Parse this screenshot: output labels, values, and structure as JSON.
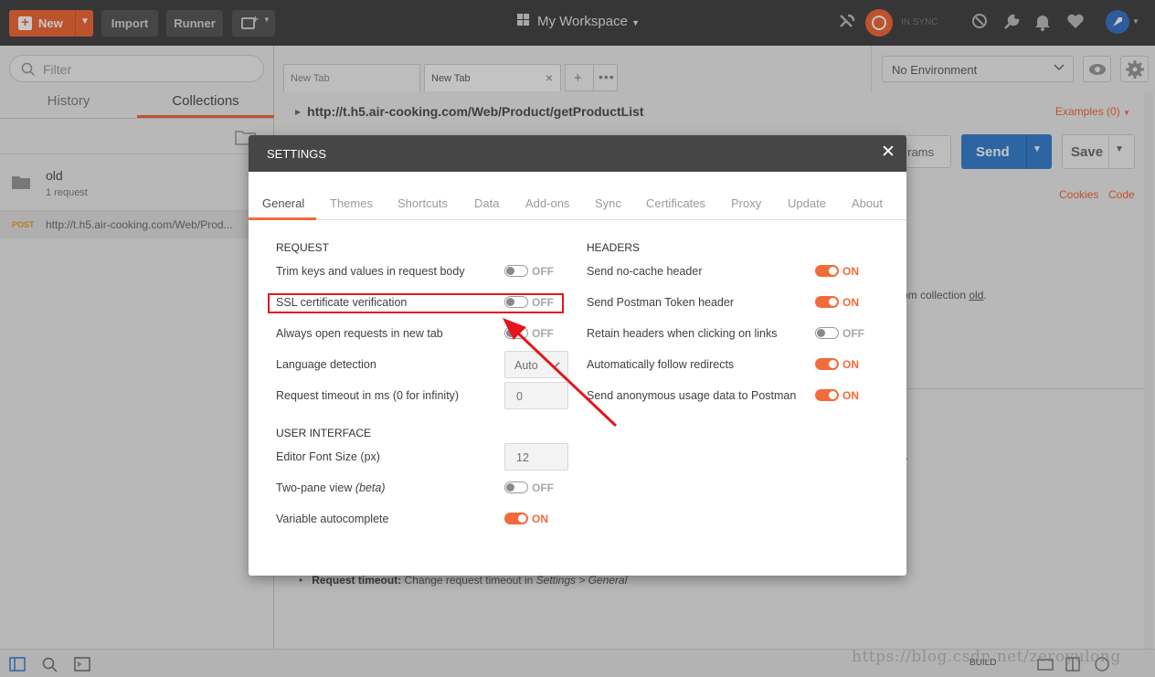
{
  "header": {
    "new_label": "New",
    "import_label": "Import",
    "runner_label": "Runner",
    "workspace_label": "My Workspace",
    "sync_status": "IN SYNC"
  },
  "sidebar": {
    "filter_placeholder": "Filter",
    "tabs": [
      {
        "label": "History",
        "active": false
      },
      {
        "label": "Collections",
        "active": true
      }
    ],
    "collection": {
      "name": "old",
      "count": "1 request"
    },
    "request": {
      "method": "POST",
      "url": "http://t.h5.air-cooking.com/Web/Prod..."
    }
  },
  "main": {
    "tabs": [
      {
        "label": "New Tab",
        "active": false
      },
      {
        "label": "New Tab",
        "active": true
      }
    ],
    "environment": "No Environment",
    "request_title": "http://t.h5.air-cooking.com/Web/Product/getProductList",
    "examples_label": "Examples (0)",
    "params_label": "rams",
    "send_label": "Send",
    "save_label": "Save",
    "cookies_label": "Cookies",
    "code_label": "Code",
    "hint_prefix": "om collection ",
    "hint_link": "old",
    "hint_suffix": ".",
    "bullet_bold": "Request timeout:",
    "bullet_text": " Change request timeout in ",
    "bullet_italic": "Settings > General"
  },
  "statusbar": {
    "build_label": "BUILD",
    "watermark": "https://blog.csdn.net/zeroyulong"
  },
  "settings": {
    "title": "SETTINGS",
    "tabs": [
      "General",
      "Themes",
      "Shortcuts",
      "Data",
      "Add-ons",
      "Sync",
      "Certificates",
      "Proxy",
      "Update",
      "About"
    ],
    "active_tab": "General",
    "request": {
      "section": "REQUEST",
      "trim_label": "Trim keys and values in request body",
      "trim_state": "OFF",
      "ssl_label": "SSL certificate verification",
      "ssl_state": "OFF",
      "newtab_label": "Always open requests in new tab",
      "newtab_state": "OFF",
      "lang_label": "Language detection",
      "lang_value": "Auto",
      "timeout_label": "Request timeout in ms (0 for infinity)",
      "timeout_value": "0"
    },
    "ui": {
      "section": "USER INTERFACE",
      "font_label": "Editor Font Size (px)",
      "font_value": "12",
      "twopane_label": "Two-pane view",
      "twopane_beta": "(beta)",
      "twopane_state": "OFF",
      "autocomplete_label": "Variable autocomplete",
      "autocomplete_state": "ON"
    },
    "headers": {
      "section": "HEADERS",
      "nocache_label": "Send no-cache header",
      "nocache_state": "ON",
      "token_label": "Send Postman Token header",
      "token_state": "ON",
      "retain_label": "Retain headers when clicking on links",
      "retain_state": "OFF",
      "redirect_label": "Automatically follow redirects",
      "redirect_state": "ON",
      "anon_label": "Send anonymous usage data to Postman",
      "anon_state": "ON"
    }
  },
  "colors": {
    "accent": "#f26b3a",
    "header_bg": "#464646",
    "send_blue": "#3a82d0",
    "annotation_red": "#e3161e"
  }
}
